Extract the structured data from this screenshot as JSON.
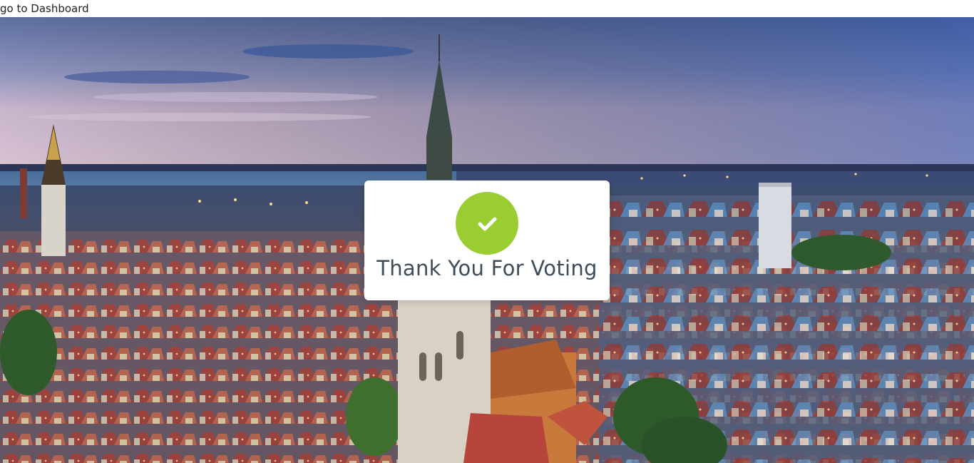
{
  "nav": {
    "dashboard_link": "go to Dashboard"
  },
  "hero": {
    "image_alt": "Panoramic city view at dusk"
  },
  "confirmation": {
    "icon": "check-icon",
    "accent_color": "#9acd32",
    "message": "Thank You For Voting"
  }
}
